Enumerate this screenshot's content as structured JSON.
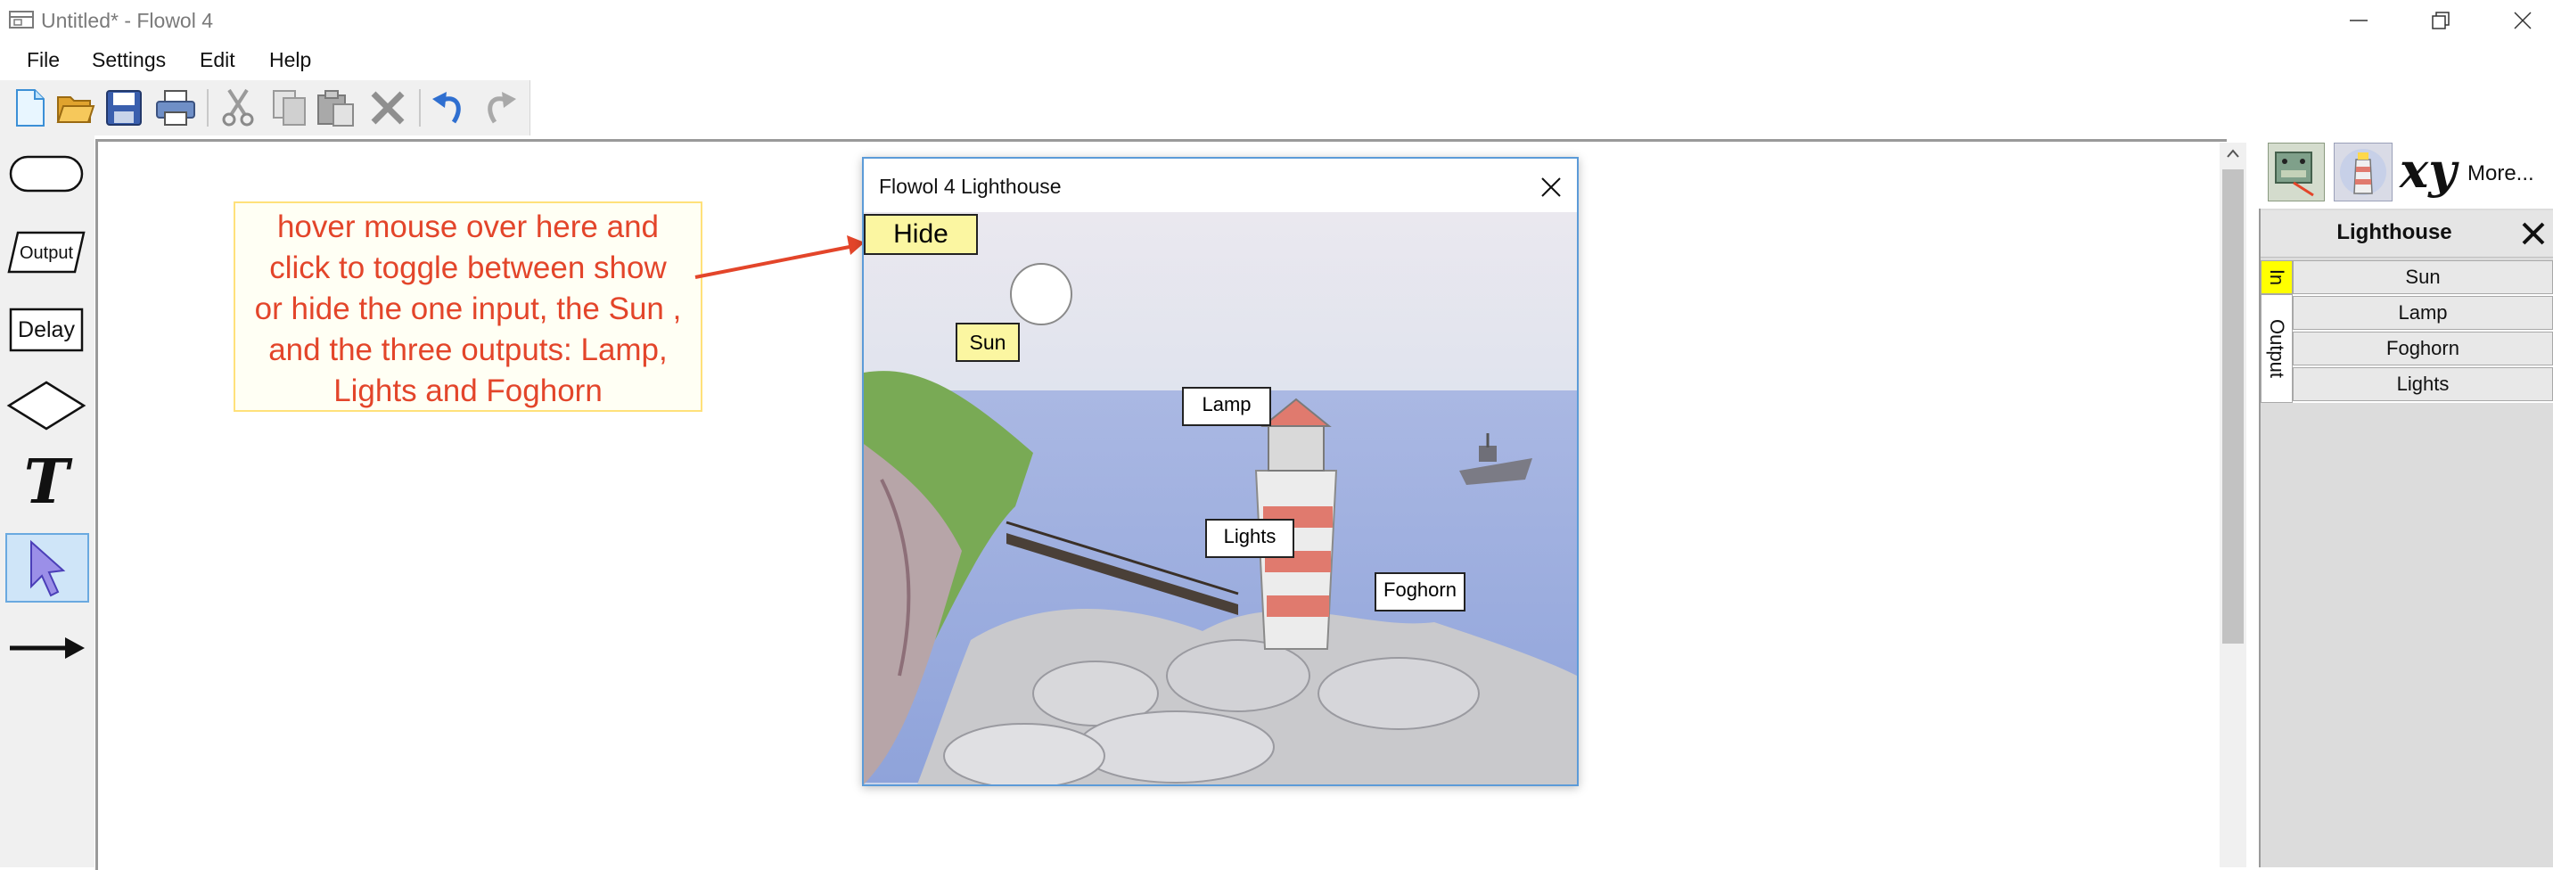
{
  "window": {
    "title": "Untitled* - Flowol 4"
  },
  "menu": {
    "items": [
      "File",
      "Settings",
      "Edit",
      "Help"
    ]
  },
  "toolbar": {
    "buttons": [
      "new-file-icon",
      "open-folder-icon",
      "save-icon",
      "print-icon",
      "cut-icon",
      "copy-icon",
      "paste-icon",
      "delete-icon",
      "undo-icon",
      "redo-icon"
    ]
  },
  "palette": {
    "output_label": "Output",
    "delay_label": "Delay",
    "text_label": "T"
  },
  "annotation": {
    "text": "hover mouse over here and\nclick to toggle between show\nor hide the one input, the Sun ,\nand the three outputs: Lamp,\nLights and Foghorn",
    "color": "#e3452a"
  },
  "lighthouse_window": {
    "title": "Flowol 4 Lighthouse",
    "hide_label": "Hide",
    "sun_label": "Sun",
    "lamp_label": "Lamp",
    "lights_label": "Lights",
    "foghorn_label": "Foghorn"
  },
  "right_panel": {
    "more_label": "More...",
    "xy_label": "xy",
    "title": "Lighthouse",
    "input_tab": "In",
    "output_tab": "Output",
    "inputs": [
      "Sun"
    ],
    "outputs": [
      "Lamp",
      "Foghorn",
      "Lights"
    ]
  },
  "colors": {
    "accent_yellow": "#fbf6a1",
    "input_tab": "#ffff00",
    "window_border": "#5c9bd8"
  }
}
